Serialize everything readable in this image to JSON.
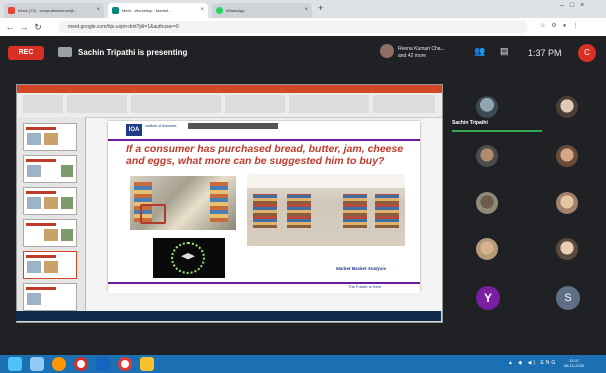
{
  "browser": {
    "tabs": [
      {
        "label": "Inbox (72) - computerscience@...",
        "active": false
      },
      {
        "label": "Meet - Workshop - Market ...",
        "active": true
      },
      {
        "label": "WhatsApp",
        "active": false
      }
    ],
    "url": "meet.google.com/hjs-uojm-dmt?pli=1&authuser=0"
  },
  "meet": {
    "rec_label": "REC",
    "presenting_text": "Sachin Tripathi is presenting",
    "participants_summary": {
      "line1": "Reena Kumari Cha...",
      "line2": "and 42 more"
    },
    "time": "1:37 PM",
    "me_initial": "C",
    "self_tile_name": "Sachin Tripathi",
    "avatar_letters": [
      "Y",
      "S"
    ],
    "colors": {
      "rec": "#d93025",
      "active_speaker": "#34a853",
      "avatar_y": "#7b1fa2",
      "avatar_s": "#5f6f86"
    }
  },
  "slide": {
    "logo_text": "IOA",
    "logo_subtitle": "Institute of Actuaries",
    "question": "If a consumer has purchased bread, butter, jam, cheese and eggs, what more can be suggested him to buy?",
    "caption": "Market Basket Analysis",
    "footer": "The Future is Here",
    "accent_color": "#c0392b"
  },
  "windows": {
    "clock_time": "13:37",
    "clock_date": "08-11-2020"
  }
}
